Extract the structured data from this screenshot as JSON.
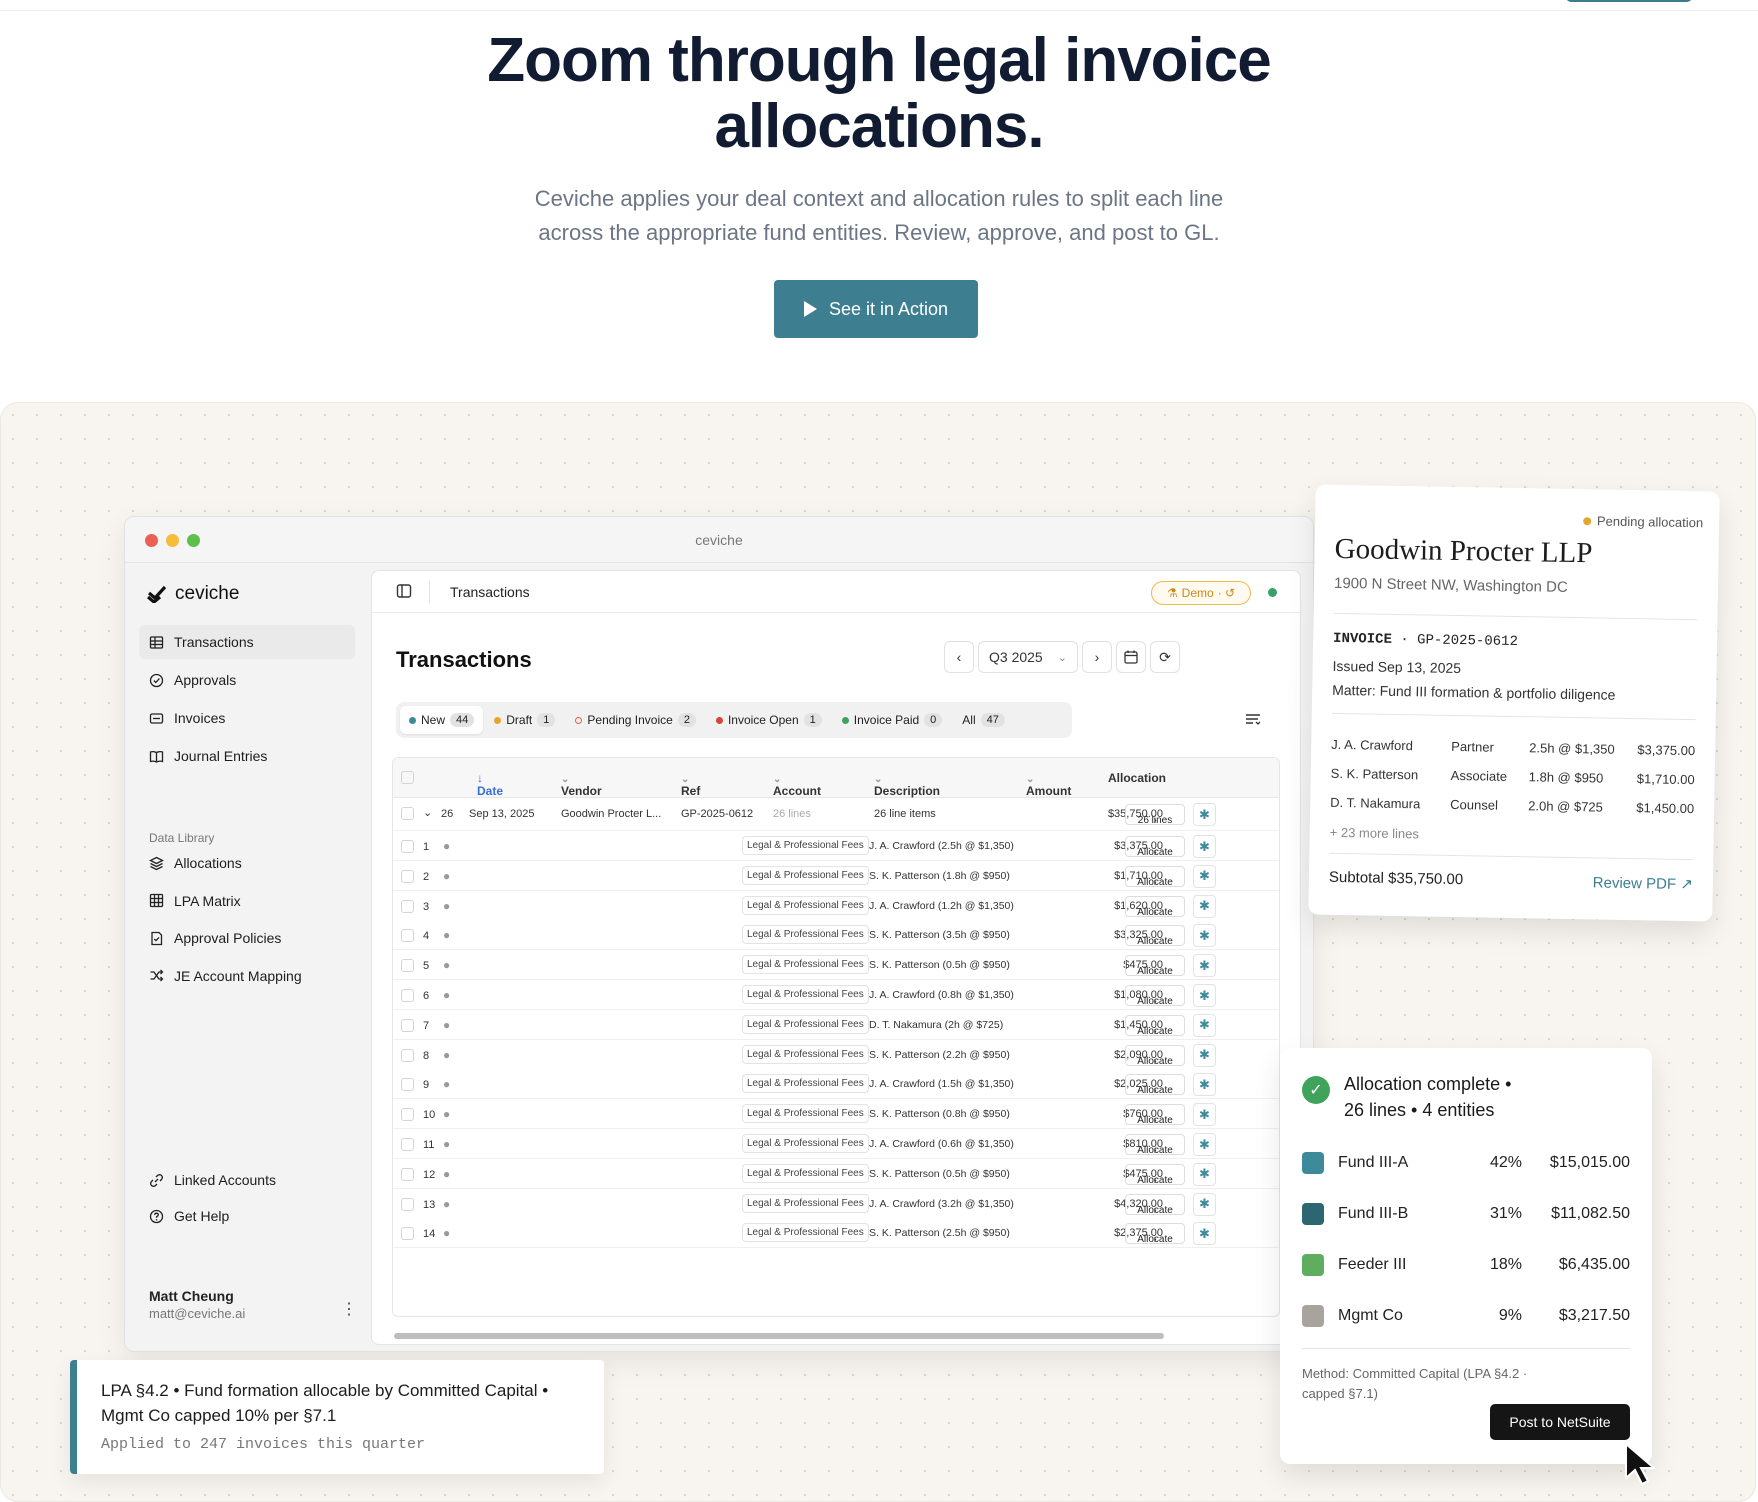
{
  "hero": {
    "title_line1": "Zoom through legal invoice",
    "title_line2": "allocations.",
    "subtitle_line1": "Ceviche applies your deal context and allocation rules to split each line",
    "subtitle_line2": "across the appropriate fund entities. Review, approve, and post to GL.",
    "cta_label": "See it in Action"
  },
  "app": {
    "window_title": "ceviche",
    "brand": "ceviche",
    "nav": [
      {
        "label": "Transactions",
        "icon": "table-icon",
        "active": true
      },
      {
        "label": "Approvals",
        "icon": "check-circle-icon"
      },
      {
        "label": "Invoices",
        "icon": "invoice-icon"
      },
      {
        "label": "Journal Entries",
        "icon": "book-icon"
      }
    ],
    "data_library_heading": "Data Library",
    "library": [
      {
        "label": "Allocations",
        "icon": "layers-icon"
      },
      {
        "label": "LPA Matrix",
        "icon": "grid-icon"
      },
      {
        "label": "Approval Policies",
        "icon": "document-check-icon"
      },
      {
        "label": "JE Account Mapping",
        "icon": "shuffle-icon"
      }
    ],
    "footer_links": [
      {
        "label": "Linked Accounts",
        "icon": "link-icon"
      },
      {
        "label": "Get Help",
        "icon": "help-icon"
      }
    ],
    "user": {
      "name": "Matt Cheung",
      "email": "matt@ceviche.ai"
    },
    "breadcrumb": "Transactions",
    "demo_badge": "Demo",
    "page_title": "Transactions",
    "period": "Q3 2025",
    "tabs": [
      {
        "label": "New",
        "count": "44",
        "color": "#3d8b9a"
      },
      {
        "label": "Draft",
        "count": "1",
        "color": "#e3a72b"
      },
      {
        "label": "Pending Invoice",
        "count": "2",
        "color": "#e0604a"
      },
      {
        "label": "Invoice Open",
        "count": "1",
        "color": "#d9433b"
      },
      {
        "label": "Invoice Paid",
        "count": "0",
        "color": "#3fa35c"
      },
      {
        "label": "All",
        "count": "47",
        "color": ""
      }
    ],
    "columns": {
      "date": "Date",
      "vendor": "Vendor",
      "ref": "Ref #",
      "account": "Account",
      "description": "Description",
      "amount": "Amount",
      "allocation": "Allocation"
    },
    "parent_row": {
      "count": "26",
      "date": "Sep 13, 2025",
      "vendor": "Goodwin Procter L...",
      "ref": "GP-2025-0612",
      "lines": "26 lines",
      "description": "26 line items",
      "amount": "$35,750.00",
      "allocation": "26 lines"
    },
    "account_label": "Legal & Professional Fees",
    "allocate_label": "Allocate",
    "rows": [
      {
        "n": "1",
        "desc": "J. A. Crawford (2.5h @ $1,350)",
        "amount": "$3,375.00"
      },
      {
        "n": "2",
        "desc": "S. K. Patterson (1.8h @ $950)",
        "amount": "$1,710.00"
      },
      {
        "n": "3",
        "desc": "J. A. Crawford (1.2h @ $1,350)",
        "amount": "$1,620.00"
      },
      {
        "n": "4",
        "desc": "S. K. Patterson (3.5h @ $950)",
        "amount": "$3,325.00"
      },
      {
        "n": "5",
        "desc": "S. K. Patterson (0.5h @ $950)",
        "amount": "$475.00"
      },
      {
        "n": "6",
        "desc": "J. A. Crawford (0.8h @ $1,350)",
        "amount": "$1,080.00"
      },
      {
        "n": "7",
        "desc": "D. T. Nakamura (2h @ $725)",
        "amount": "$1,450.00"
      },
      {
        "n": "8",
        "desc": "S. K. Patterson (2.2h @ $950)",
        "amount": "$2,090.00"
      },
      {
        "n": "9",
        "desc": "J. A. Crawford (1.5h @ $1,350)",
        "amount": "$2,025.00"
      },
      {
        "n": "10",
        "desc": "S. K. Patterson (0.8h @ $950)",
        "amount": "$760.00"
      },
      {
        "n": "11",
        "desc": "J. A. Crawford (0.6h @ $1,350)",
        "amount": "$810.00"
      },
      {
        "n": "12",
        "desc": "S. K. Patterson (0.5h @ $950)",
        "amount": "$475.00"
      },
      {
        "n": "13",
        "desc": "J. A. Crawford (3.2h @ $1,350)",
        "amount": "$4,320.00"
      },
      {
        "n": "14",
        "desc": "S. K. Patterson (2.5h @ $950)",
        "amount": "$2,375.00"
      }
    ]
  },
  "invoice": {
    "status": "Pending allocation",
    "firm": "Goodwin Procter LLP",
    "address": "1900 N Street NW, Washington DC",
    "label": "INVOICE",
    "number": "GP-2025-0612",
    "issued": "Issued Sep 13, 2025",
    "matter": "Matter: Fund III formation & portfolio diligence",
    "lines": [
      {
        "name": "J. A. Crawford",
        "role": "Partner",
        "hours": "2.5h @ $1,350",
        "amount": "$3,375.00"
      },
      {
        "name": "S. K. Patterson",
        "role": "Associate",
        "hours": "1.8h @ $950",
        "amount": "$1,710.00"
      },
      {
        "name": "D. T. Nakamura",
        "role": "Counsel",
        "hours": "2.0h @ $725",
        "amount": "$1,450.00"
      }
    ],
    "more": "+ 23 more lines",
    "subtotal": "Subtotal $35,750.00",
    "review": "Review PDF"
  },
  "allocation": {
    "title": "Allocation complete",
    "subtitle": "26 lines  •  4 entities",
    "entities": [
      {
        "name": "Fund III-A",
        "pct": "42%",
        "amount": "$15,015.00",
        "color": "#3d8b9a"
      },
      {
        "name": "Fund III-B",
        "pct": "31%",
        "amount": "$11,082.50",
        "color": "#2b6672"
      },
      {
        "name": "Feeder III",
        "pct": "18%",
        "amount": "$6,435.00",
        "color": "#5fae5f"
      },
      {
        "name": "Mgmt Co",
        "pct": "9%",
        "amount": "$3,217.50",
        "color": "#a8a39d"
      }
    ],
    "method": "Method: Committed Capital (LPA §4.2 · capped §7.1)",
    "post_label": "Post to NetSuite"
  },
  "lpa_note": {
    "text": "LPA §4.2  •  Fund formation allocable by Committed Capital •  Mgmt Co capped 10% per §7.1",
    "applied": "Applied to 247 invoices this quarter"
  }
}
